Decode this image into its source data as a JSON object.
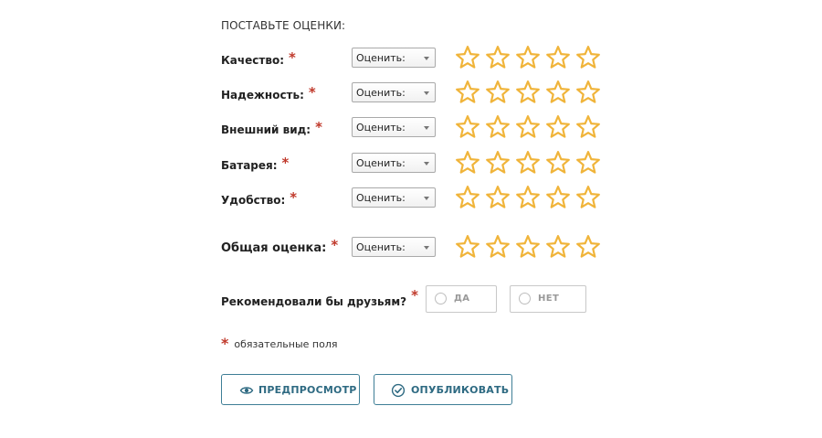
{
  "heading": "ПОСТАВЬТЕ ОЦЕНКИ:",
  "required_mark": "*",
  "colors": {
    "star": "#f0b43a",
    "required": "#c0392b",
    "button_border": "#3e7e96",
    "button_text": "#2e6a82"
  },
  "ratings": [
    {
      "label": "Качество:",
      "select_value": "Оценить:",
      "stars_filled": 0,
      "stars_total": 5
    },
    {
      "label": "Надежность:",
      "select_value": "Оценить:",
      "stars_filled": 0,
      "stars_total": 5
    },
    {
      "label": "Внешний вид:",
      "select_value": "Оценить:",
      "stars_filled": 0,
      "stars_total": 5
    },
    {
      "label": "Батарея:",
      "select_value": "Оценить:",
      "stars_filled": 0,
      "stars_total": 5
    },
    {
      "label": "Удобство:",
      "select_value": "Оценить:",
      "stars_filled": 0,
      "stars_total": 5
    }
  ],
  "overall": {
    "label": "Общая оценка:",
    "select_value": "Оценить:",
    "stars_filled": 0,
    "stars_total": 5
  },
  "recommend": {
    "label": "Рекомендовали бы друзьям?",
    "yes": "ДА",
    "no": "НЕТ",
    "selected": null
  },
  "note": "обязательные поля",
  "buttons": {
    "preview": "ПРЕДПРОСМОТР",
    "publish": "ОПУБЛИКОВАТЬ"
  },
  "icons": {
    "star": "star-outline-icon",
    "select": "chevron-down-icon",
    "preview": "eye-icon",
    "publish": "check-circle-icon"
  }
}
